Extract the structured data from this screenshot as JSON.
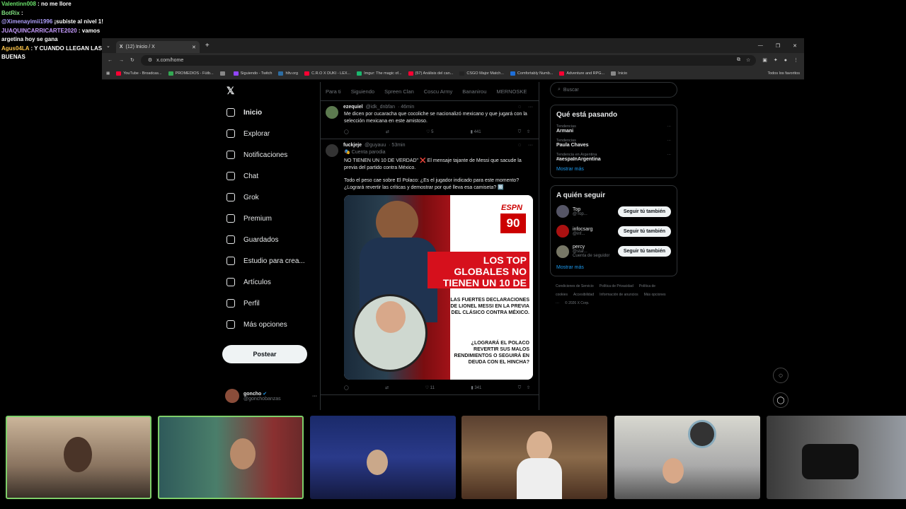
{
  "chat": [
    {
      "user": "Valentinn008",
      "color": "#6be36b",
      "msg": " : no me llore"
    },
    {
      "user": "BotRix",
      "color": "#7fe07f",
      "msg": " :"
    },
    {
      "user": "@Ximenayimii1996",
      "color": "#b0a0ff",
      "msg": " ¡subiste al nivel 1!"
    },
    {
      "user": "JUAQUINCARRICARTE2020",
      "color": "#c79cff",
      "msg": " : vamos argetina hoy se gana"
    },
    {
      "user": "Agus04LA",
      "color": "#ffc64a",
      "msg": " : Y CUANDO LLEGAN LAS BUENAS"
    }
  ],
  "browser": {
    "tab_title": "(12) Inicio / X",
    "url": "x.com/home",
    "bookmarks": [
      {
        "label": "YouTube - Broadcas...",
        "color": "#ff0033"
      },
      {
        "label": "PROMEDIOS - Fútb...",
        "color": "#34a853"
      },
      {
        "label": "",
        "color": "#888"
      },
      {
        "label": "Siguiendo - Twitch",
        "color": "#9146ff"
      },
      {
        "label": "hltv.org",
        "color": "#2d6da3"
      },
      {
        "label": "C.R.O X DUKI - LEX...",
        "color": "#ff0033"
      },
      {
        "label": "Imgur: The magic of...",
        "color": "#1bb76e"
      },
      {
        "label": "(57) Análisis del can...",
        "color": "#ff0033"
      },
      {
        "label": "CSGO Major Match...",
        "color": "#222"
      },
      {
        "label": "Comfortably Numb...",
        "color": "#1e6fd9"
      },
      {
        "label": "Adventure and RPG...",
        "color": "#ff0033"
      },
      {
        "label": "Inicio",
        "color": "#888"
      }
    ],
    "favorites": "Todos los favoritos"
  },
  "nav": {
    "items": [
      {
        "label": "Inicio",
        "icon": "home-icon"
      },
      {
        "label": "Explorar",
        "icon": "search-icon"
      },
      {
        "label": "Notificaciones",
        "icon": "bell-icon"
      },
      {
        "label": "Chat",
        "icon": "chat-icon"
      },
      {
        "label": "Grok",
        "icon": "grok-icon"
      },
      {
        "label": "Premium",
        "icon": "premium-icon"
      },
      {
        "label": "Guardados",
        "icon": "bookmark-icon"
      },
      {
        "label": "Estudio para crea...",
        "icon": "rocket-icon"
      },
      {
        "label": "Artículos",
        "icon": "article-icon"
      },
      {
        "label": "Perfil",
        "icon": "profile-icon"
      },
      {
        "label": "Más opciones",
        "icon": "more-icon"
      }
    ],
    "post_label": "Postear",
    "me_name": "goncho",
    "me_handle": "@gonchobanzas"
  },
  "feed": {
    "tabs": [
      "Para ti",
      "Siguiendo",
      "Spreen Clan",
      "Coscu Army",
      "Bananirou",
      "MERNOSKE"
    ],
    "tweet1": {
      "name": "ezequiel",
      "handle": "@idk_dnbfan",
      "time": "· 46min",
      "text": "Me dicen por cucaracha que cocoliche se nacionalizó mexicano y que jugará con la selección mexicana en este amistoso.",
      "likes": "5",
      "views": "441"
    },
    "tweet2": {
      "name": "fuckjeje",
      "handle": "@guyauu",
      "time": "· 53min",
      "parody": "Cuenta parodia",
      "text1": "NO TIENEN UN 10 DE VERDAD\" ❌ El mensaje tajante de Messi que sacude la previa del partido contra México.",
      "text2": "Todo el peso cae sobre El Polaco: ¿Es el jugador indicado para este momento? ¿Logrará revertir las críticas y demostrar por qué lleva esa camiseta? 🔟",
      "img_brand": "ESPN",
      "img_num": "90",
      "img_headline": "LOS TOP GLOBALES NO TIENEN UN 10 DE VERDAD",
      "img_sub": "LAS FUERTES DECLARACIONES DE LIONEL MESSI EN LA PREVIA DEL CLÁSICO CONTRA MÉXICO.",
      "img_q": "¿LOGRARÁ EL POLACO REVERTIR SUS MALOS RENDIMIENTOS O SEGUIRÁ EN DEUDA CON EL HINCHA?",
      "likes": "11",
      "views": "341"
    }
  },
  "right": {
    "search_placeholder": "Buscar",
    "trends_title": "Qué está pasando",
    "trends": [
      {
        "ctx": "Tendencias",
        "name": "Armani"
      },
      {
        "ctx": "Tendencias",
        "name": "Paula Chaves"
      },
      {
        "ctx": "Tendencia en Argentina",
        "name": "#aespaInArgentina"
      }
    ],
    "more": "Mostrar más",
    "follow_title": "A quién seguir",
    "follow": [
      {
        "name": "Top",
        "handle": "@Top..."
      },
      {
        "name": "infocsarg",
        "handle": "@inf..."
      },
      {
        "name": "percy",
        "handle": "@star...",
        "note": "Cuenta de seguidor"
      }
    ],
    "follow_btn": "Seguir tú también",
    "more2": "Mostrar más",
    "footer": [
      "Condiciones de Servicio",
      "Política de Privacidad",
      "Política de cookies",
      "Accesibilidad",
      "Información de anuncios",
      "Más opciones ···",
      "© 2026 X Corp."
    ]
  },
  "colors": {
    "accent": "#1d9bf0",
    "cam_border": "#7ecf6a"
  }
}
